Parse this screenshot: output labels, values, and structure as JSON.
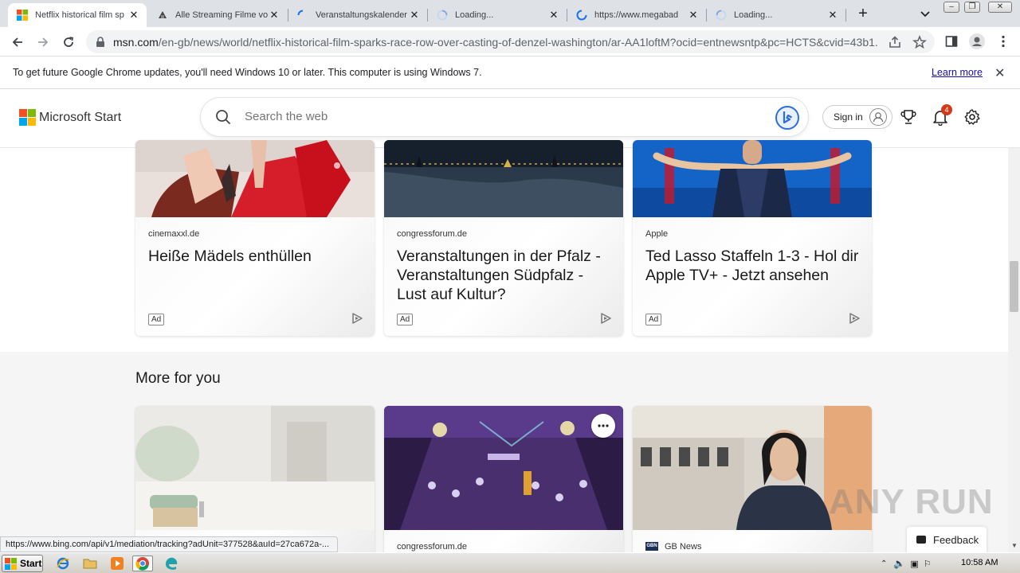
{
  "browser": {
    "tabs": [
      {
        "title": "Netflix historical film sp",
        "favicon": "microsoft-icon"
      },
      {
        "title": "Alle Streaming Filme vo",
        "favicon": "streaming-icon"
      },
      {
        "title": "Veranstaltungskalender",
        "favicon": "loading-spinner-icon"
      },
      {
        "title": "Loading...",
        "favicon": "loading-spinner-icon"
      },
      {
        "title": "https://www.megabad",
        "favicon": "loading-spinner-icon"
      },
      {
        "title": "Loading...",
        "favicon": "loading-spinner-icon"
      }
    ],
    "url_host": "msn.com",
    "url_path": "/en-gb/news/world/netflix-historical-film-sparks-race-row-over-casting-of-denzel-washington/ar-AA1loftM?ocid=entnewsntp&pc=HCTS&cvid=43b1...",
    "infobar_message": "To get future Google Chrome updates, you'll need Windows 10 or later. This computer is using Windows 7.",
    "infobar_link": "Learn more",
    "status_url": "https://www.bing.com/api/v1/mediation/tracking?adUnit=377528&auId=27ca672a-..."
  },
  "msn": {
    "brand": "Microsoft Start",
    "search_placeholder": "Search the web",
    "sign_in": "Sign in",
    "notification_count": "4",
    "more_for_you": "More for you",
    "feedback": "Feedback",
    "ad_label": "Ad"
  },
  "ad_cards": [
    {
      "source": "cinemaxxl.de",
      "title": "Heiße Mädels enthüllen"
    },
    {
      "source": "congressforum.de",
      "title": "Veranstaltungen in der Pfalz - Veranstaltungen Südpfalz - Lust auf Kultur?"
    },
    {
      "source": "Apple",
      "title": "Ted Lasso Staffeln 1-3 - Hol dir Apple TV+ - Jetzt ansehen"
    }
  ],
  "more_cards": [
    {
      "source": ""
    },
    {
      "source": "congressforum.de"
    },
    {
      "source": "GB News",
      "source_logo": "GBN"
    }
  ],
  "watermark": "ANY RUN",
  "taskbar": {
    "start": "Start",
    "clock": "10:58 AM"
  }
}
